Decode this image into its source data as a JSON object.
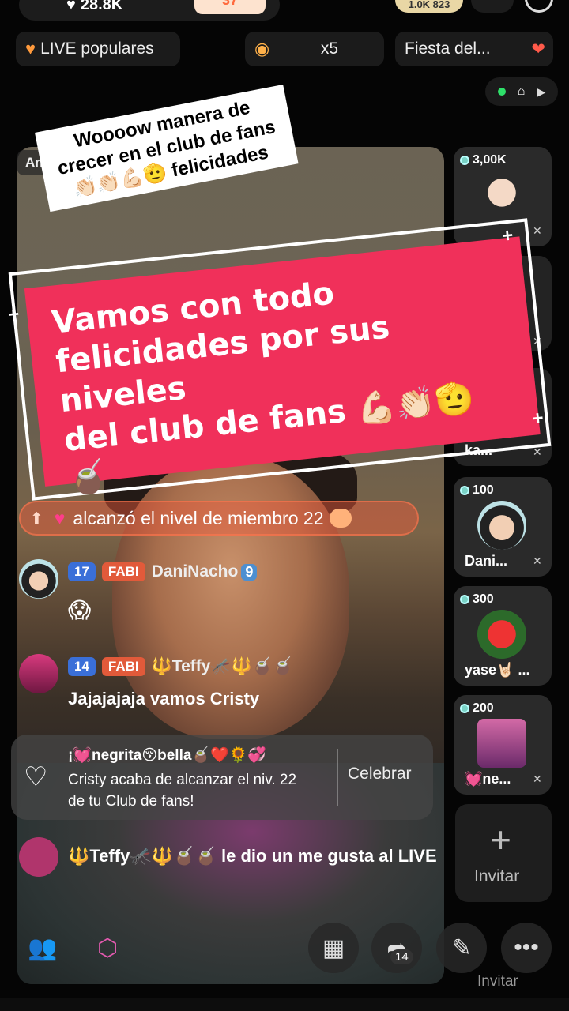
{
  "top": {
    "likes": "28.8K",
    "orange_badge": "37",
    "badge_right": "1.0K 823"
  },
  "pills": {
    "live": "LIVE populares",
    "multiplier": "x5",
    "fiesta": "Fiesta del..."
  },
  "video": {
    "host_label": "Anfitri..."
  },
  "sticker": {
    "line1": "Woooow manera de",
    "line2": "crecer en el club de fans",
    "line3": "👏🏻👏🏻💪🏻🫡 felicidades"
  },
  "banner": {
    "line1": "Vamos con todo",
    "line2": "felicidades por sus niveles",
    "line3": "del club de fans 💪🏻👏🏻🫡🧉"
  },
  "levelup": {
    "text": "alcanzó el nivel de miembro 22"
  },
  "comments": [
    {
      "level": "17",
      "fan": "FABI",
      "user": "DaniNacho",
      "user_level": "9",
      "msg": "😱"
    },
    {
      "level": "14",
      "fan": "FABI",
      "user": "🔱Teffy🦟🔱🧉🧉",
      "msg": "Jajajajaja vamos Cristy"
    }
  ],
  "celebrate": {
    "user": "¡💓negrita😚bella🧉❤️🌻💞",
    "text": "Cristy acaba de alcanzar el niv. 22 de tu Club de fans!",
    "button": "Celebrar"
  },
  "liked": {
    "user": "🔱Teffy🦟🔱🧉🧉",
    "text": "le dio un me gusta al LIVE"
  },
  "guests": [
    {
      "score": "3,00K",
      "name": ""
    },
    {
      "score": "",
      "name": "ka..."
    },
    {
      "score": "100",
      "name": "Dani..."
    },
    {
      "score": "300",
      "name": "yase🤘🏻 ..."
    },
    {
      "score": "200",
      "name": "💓ne..."
    }
  ],
  "invite": "Invitar",
  "share_count": "14",
  "icons": [
    "heart-icon",
    "home-icon",
    "people-icon",
    "gift-box-icon",
    "video-icon",
    "share-icon",
    "magic-wand-icon",
    "more-icon"
  ],
  "colors": {
    "banner": "#f0305a",
    "accent_orange": "#ff9a3c"
  }
}
